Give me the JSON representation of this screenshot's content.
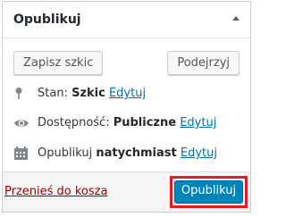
{
  "panel": {
    "title": "Opublikuj"
  },
  "actions": {
    "save_draft_label": "Zapisz szkic",
    "preview_label": "Podejrzyj"
  },
  "status": {
    "label": "Stan:",
    "value": "Szkic",
    "edit_label": "Edytuj",
    "icon": "pin-icon"
  },
  "visibility": {
    "label": "Dostępność:",
    "value": "Publiczne",
    "edit_label": "Edytuj",
    "icon": "eye-icon"
  },
  "schedule": {
    "label": "Opublikuj",
    "value": "natychmiast",
    "edit_label": "Edytuj",
    "icon": "calendar-icon"
  },
  "footer": {
    "trash_label": "Przenieś do kosza",
    "publish_label": "Opublikuj"
  },
  "colors": {
    "primary": "#0085ba",
    "link": "#0073aa",
    "trash": "#a00000",
    "highlight": "#e21b24"
  }
}
